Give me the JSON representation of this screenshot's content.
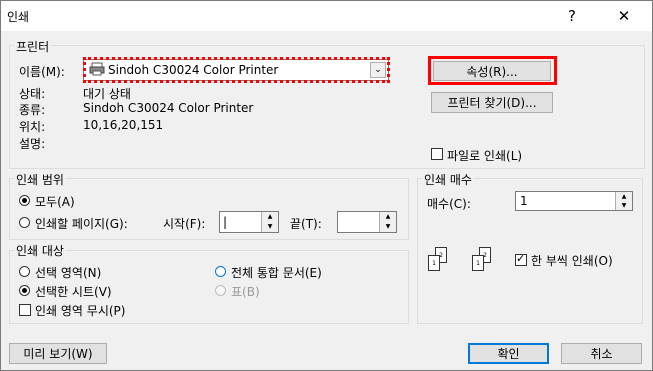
{
  "dialog": {
    "title": "인쇄",
    "help": "?",
    "close": "✕"
  },
  "printer": {
    "group": "프린터",
    "name_label": "이름(M):",
    "name_value": "Sindoh C30024 Color Printer",
    "status_label": "상태:",
    "status_value": "대기 상태",
    "type_label": "종류:",
    "type_value": "Sindoh C30024 Color Printer",
    "where_label": "위치:",
    "where_value": "10,16,20,151",
    "comment_label": "설명:",
    "properties_btn": "속성(R)...",
    "find_btn": "프린터 찾기(D)...",
    "print_to_file": "파일로 인쇄(L)"
  },
  "range": {
    "group": "인쇄 범위",
    "all": "모두(A)",
    "pages": "인쇄할 페이지(G):",
    "from_label": "시작(F):",
    "from_value": "|",
    "to_label": "끝(T):",
    "to_value": ""
  },
  "copies": {
    "group": "인쇄 매수",
    "count_label": "매수(C):",
    "count_value": "1",
    "collate": "한 부씩 인쇄(O)",
    "collate_icon_pages_1": [
      "1",
      "2"
    ],
    "collate_icon_pages_2": [
      "1",
      "2"
    ]
  },
  "target": {
    "group": "인쇄 대상",
    "selection": "선택 영역(N)",
    "selected_sheet": "선택한 시트(V)",
    "entire_workbook": "전체 통합 문서(E)",
    "table": "표(B)",
    "ignore_area": "인쇄 영역 무시(P)"
  },
  "footer": {
    "preview": "미리 보기(W)",
    "ok": "확인",
    "cancel": "취소"
  },
  "colors": {
    "accent": "#0078d7",
    "highlight": "#ff0000",
    "background": "#f0f0f0"
  }
}
